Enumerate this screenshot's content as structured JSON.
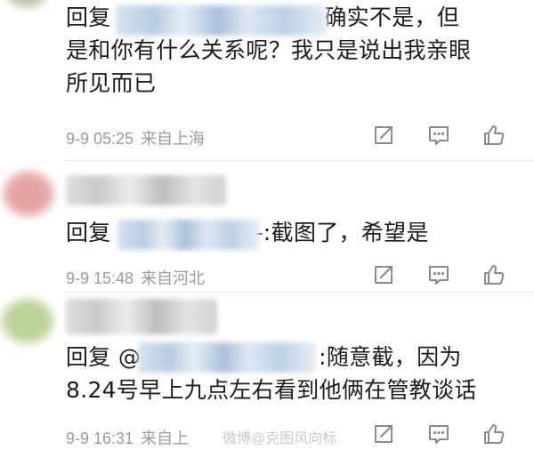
{
  "comments": [
    {
      "reply_prefix": "回复",
      "text_line1_tail": ":确实不是，但",
      "text_line2": "是和你有什么关系呢？我只是说出我亲眼",
      "text_line3": "所见而已",
      "date": "9-9 05:25",
      "location": "来自上海"
    },
    {
      "reply_prefix": "回复",
      "text_tail": "-:截图了，希望是",
      "date": "9-9 15:48",
      "location": "来自河北"
    },
    {
      "reply_prefix": "回复 @",
      "text_line1_tail": ":随意截，因为",
      "text_line2": "8.24号早上九点左右看到他俩在管教谈话",
      "date": "9-9 16:31",
      "location": "来自上"
    }
  ],
  "icons": {
    "share": "share-icon",
    "comment": "comment-icon",
    "like": "like-icon"
  },
  "watermark": "微博@克图风向标"
}
